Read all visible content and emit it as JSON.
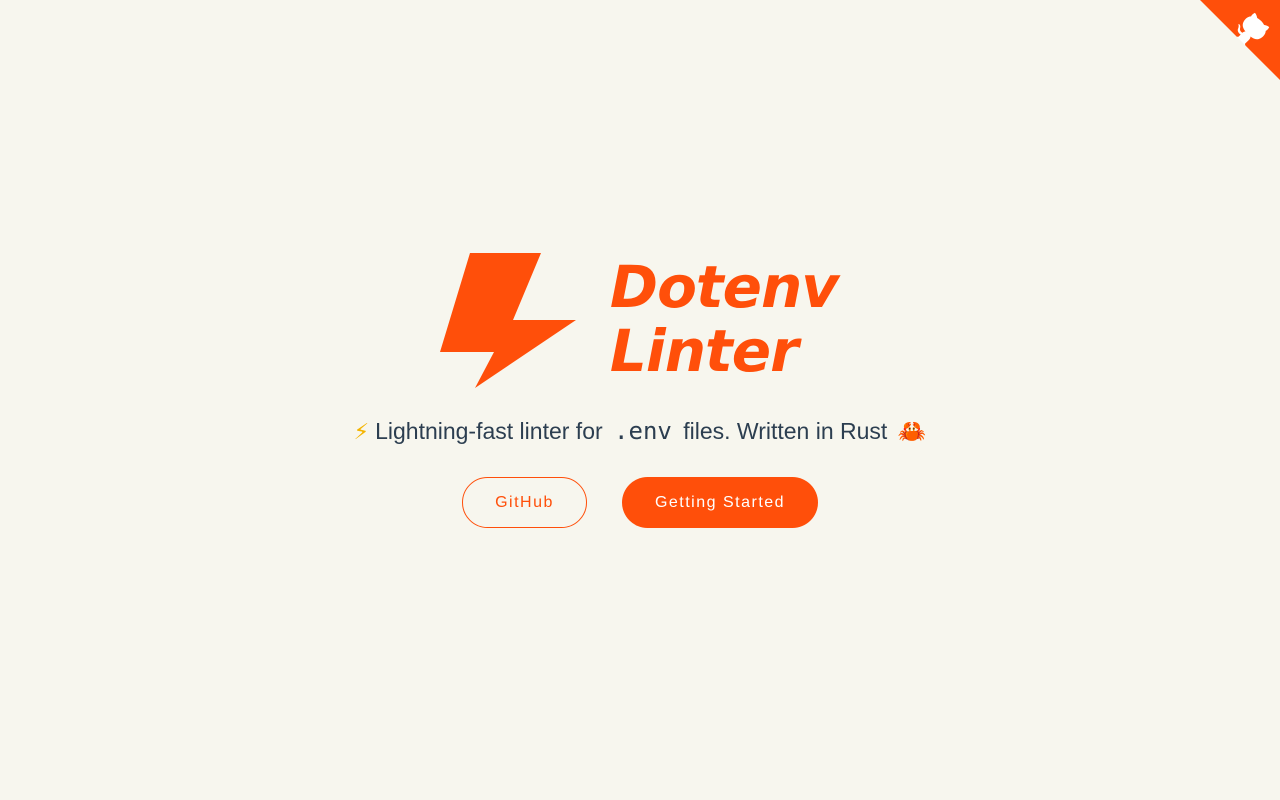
{
  "colors": {
    "background": "#f7f6ee",
    "accent": "#ff4f0a",
    "text": "#2c3e50"
  },
  "corner": {
    "icon": "github-octocat-icon"
  },
  "logo": {
    "icon": "lightning-bolt-icon",
    "line1": "Dotenv",
    "line2": "Linter"
  },
  "tagline": {
    "emoji_start": "⚡",
    "before_code": "Lightning-fast linter for",
    "code": ".env",
    "after_code": "files. Written in Rust",
    "emoji_end": "🦀"
  },
  "buttons": {
    "github": "GitHub",
    "getting_started": "Getting Started"
  }
}
